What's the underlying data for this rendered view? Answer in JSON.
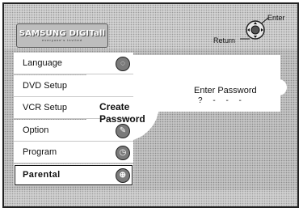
{
  "header": {
    "logo_main": "SAMSUNG DIGITall",
    "logo_sub": "everyone's invited",
    "return_label": "Return",
    "enter_label": "Enter"
  },
  "menu": {
    "items": [
      {
        "label": "Language",
        "icon": "language-icon"
      },
      {
        "label": "DVD Setup",
        "icon": "disc-icon"
      },
      {
        "label": "VCR Setup",
        "icon": "tape-icon"
      },
      {
        "label": "Option",
        "icon": "wrench-icon"
      },
      {
        "label": "Program",
        "icon": "clock-icon"
      },
      {
        "label": "Parental",
        "icon": "lock-icon",
        "selected": true
      }
    ]
  },
  "popup": {
    "section_title": "Create\nPassword",
    "prompt": "Enter Password",
    "digits": "? - - -"
  },
  "colors": {
    "background": "#c4c4c4",
    "panel": "#ffffff",
    "text": "#111111"
  }
}
